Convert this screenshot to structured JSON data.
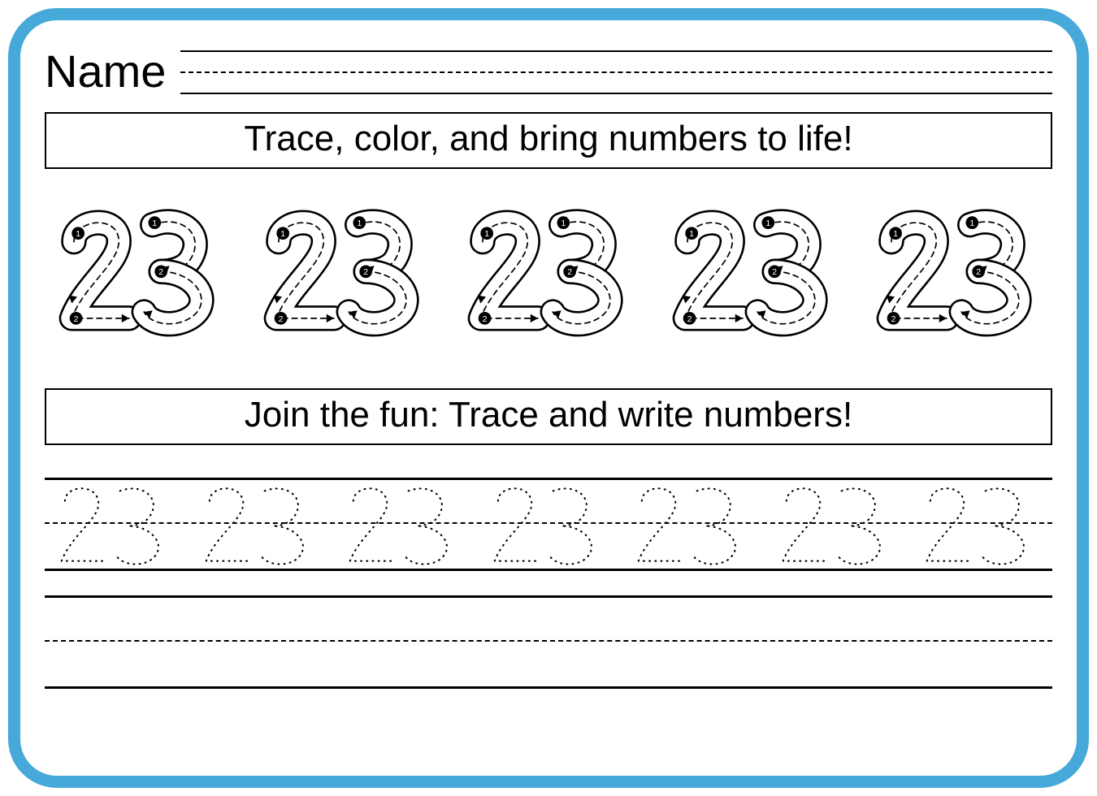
{
  "header": {
    "name_label": "Name"
  },
  "instruction1": "Trace, color, and bring numbers to life!",
  "instruction2": "Join the fun: Trace and write numbers!",
  "number": "23",
  "trace_count": 5,
  "dotted_count": 7
}
